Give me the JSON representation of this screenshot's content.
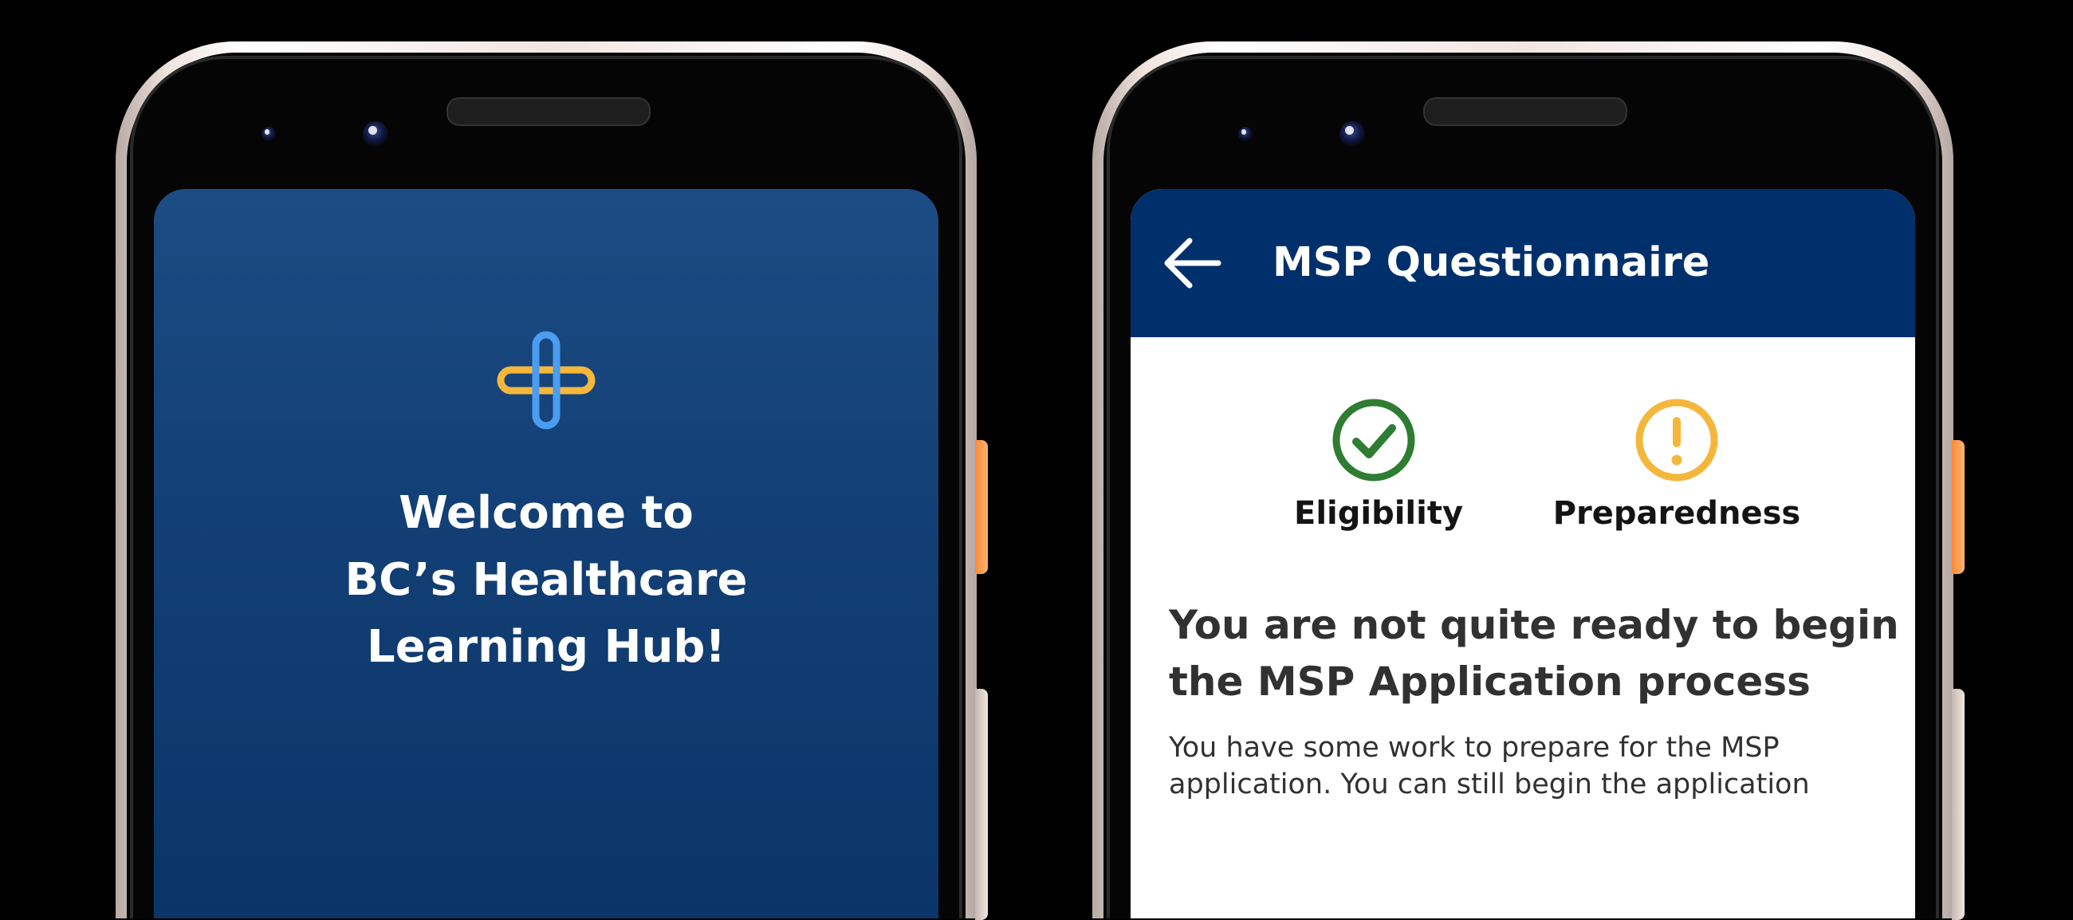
{
  "welcome_screen": {
    "title_lines": [
      "Welcome to",
      "BC’s Healthcare",
      "Learning Hub!"
    ]
  },
  "questionnaire_screen": {
    "app_bar": {
      "title": "MSP Questionnaire",
      "back_icon": "arrow-left-icon"
    },
    "status": [
      {
        "label": "Eligibility",
        "icon": "check-circle-icon",
        "color": "#2e7d32"
      },
      {
        "label": "Preparedness",
        "icon": "exclamation-circle-icon",
        "color": "#f5b73b"
      }
    ],
    "headline_lines": [
      "You are not quite ready to begin",
      "the MSP Application process"
    ],
    "body_lines": [
      "You have some work to prepare for the MSP",
      "application. You can still begin the application"
    ]
  },
  "colors": {
    "welcome_background": "#123f75",
    "app_bar": "#00306b",
    "logo_yellow": "#f5b73b",
    "logo_blue": "#4a9df0",
    "success": "#2e7d32",
    "warning": "#f5b73b",
    "text_dark": "#313132",
    "power_button": "#ff9a4a"
  }
}
